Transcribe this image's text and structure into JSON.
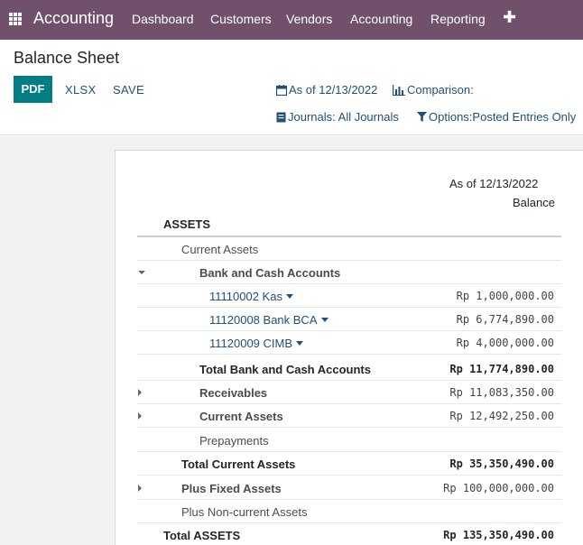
{
  "navbar": {
    "brand": "Accounting",
    "items": [
      "Dashboard",
      "Customers",
      "Vendors",
      "Accounting",
      "Reporting"
    ],
    "plus": "✚"
  },
  "control_panel": {
    "title": "Balance Sheet",
    "buttons": {
      "pdf": "PDF",
      "xlsx": "XLSX",
      "save": "SAVE"
    },
    "filters": {
      "date": "As of 12/13/2022",
      "comparison": "Comparison:",
      "journals": "Journals: All Journals",
      "options": "Options:Posted Entries Only"
    }
  },
  "report": {
    "column_date": "As of 12/13/2022",
    "column_balance": "Balance",
    "section": "ASSETS",
    "rows": [
      {
        "label": "Current Assets",
        "amount": ""
      },
      {
        "label": "Bank and Cash Accounts",
        "amount": ""
      },
      {
        "label": "11110002 Kas",
        "amount": "Rp 1,000,000.00"
      },
      {
        "label": "11120008 Bank BCA",
        "amount": "Rp 6,774,890.00"
      },
      {
        "label": "11120009 CIMB",
        "amount": "Rp 4,000,000.00"
      },
      {
        "label": "Total Bank and Cash Accounts",
        "amount": "Rp 11,774,890.00"
      },
      {
        "label": "Receivables",
        "amount": "Rp 11,083,350.00"
      },
      {
        "label": "Current Assets",
        "amount": "Rp 12,492,250.00"
      },
      {
        "label": "Prepayments",
        "amount": ""
      },
      {
        "label": "Total Current Assets",
        "amount": "Rp 35,350,490.00"
      },
      {
        "label": "Plus Fixed Assets",
        "amount": "Rp 100,000,000.00"
      },
      {
        "label": "Plus Non-current Assets",
        "amount": ""
      },
      {
        "label": "Total ASSETS",
        "amount": "Rp 135,350,490.00"
      }
    ]
  },
  "colors": {
    "navbar": "#71506b",
    "primary": "#017e84",
    "link": "#1f4f7a"
  }
}
